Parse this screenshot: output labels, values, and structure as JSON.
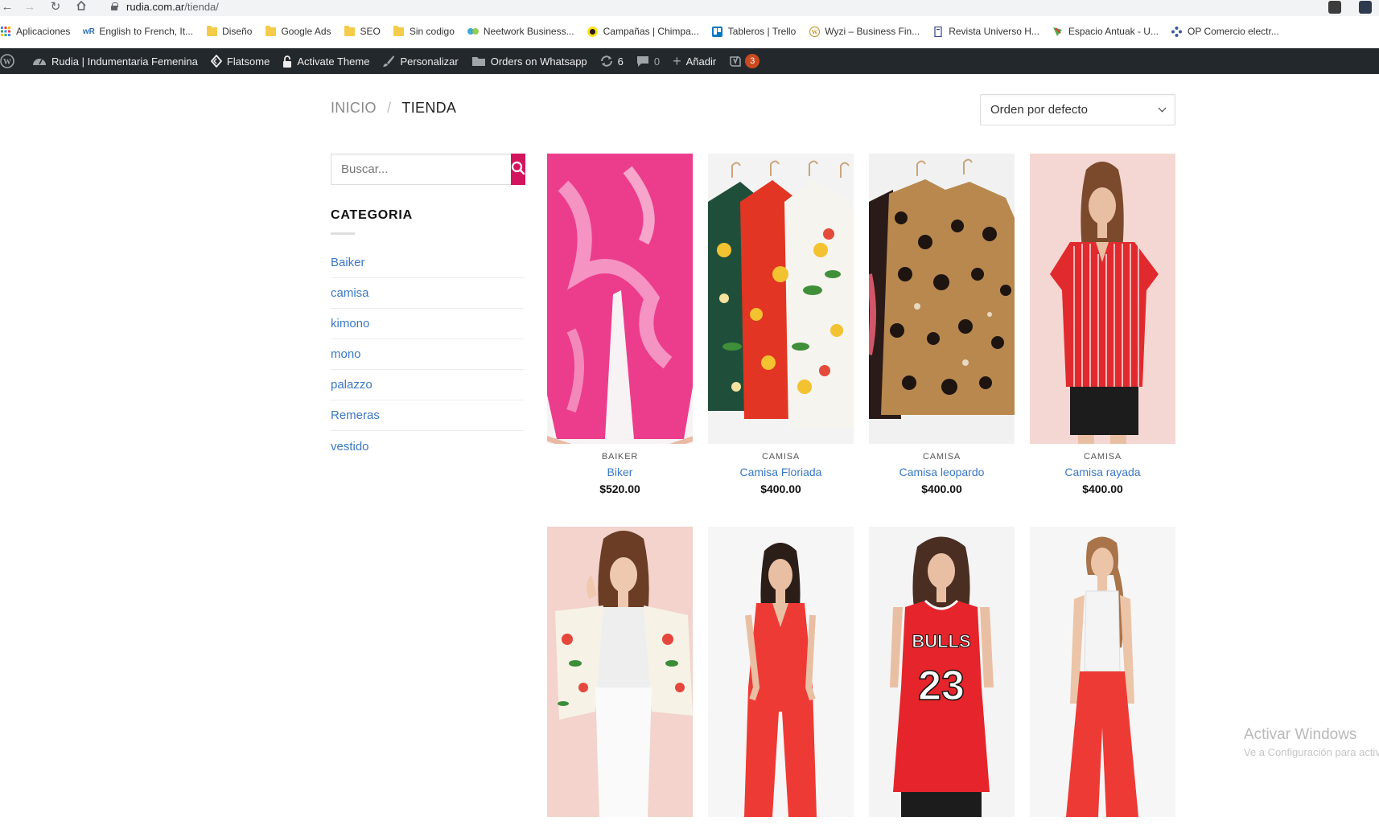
{
  "browser": {
    "url_host": "rudia.com.ar",
    "url_path": "/tienda/",
    "bookmarks": [
      {
        "label": "Aplicaciones",
        "icon": "apps-grid-icon"
      },
      {
        "label": "English to French, It...",
        "icon": "wordreference-icon"
      },
      {
        "label": "Diseño",
        "icon": "folder-icon"
      },
      {
        "label": "Google Ads",
        "icon": "folder-icon"
      },
      {
        "label": "SEO",
        "icon": "folder-icon"
      },
      {
        "label": "Sin codigo",
        "icon": "folder-icon"
      },
      {
        "label": "Neetwork Business...",
        "icon": "neetwork-icon"
      },
      {
        "label": "Campañas | Chimpa...",
        "icon": "mailchimp-icon"
      },
      {
        "label": "Tableros | Trello",
        "icon": "trello-icon"
      },
      {
        "label": "Wyzi – Business Fin...",
        "icon": "wordpress-icon"
      },
      {
        "label": "Revista Universo H...",
        "icon": "page-icon"
      },
      {
        "label": "Espacio Antuak - U...",
        "icon": "antuak-icon"
      },
      {
        "label": "OP Comercio electr...",
        "icon": "op-icon"
      }
    ]
  },
  "adminbar": {
    "site_name": "Rudia | Indumentaria Femenina",
    "flatsome": "Flatsome",
    "activate": "Activate Theme",
    "customize": "Personalizar",
    "whatsapp": "Orders on Whatsapp",
    "updates_count": "6",
    "comments_count": "0",
    "add_new": "Añadir",
    "yoast_badge": "3"
  },
  "breadcrumb": {
    "home": "INICIO",
    "separator": "/",
    "current": "TIENDA"
  },
  "orderby": {
    "selected": "Orden por defecto"
  },
  "search": {
    "placeholder": "Buscar..."
  },
  "sidebar": {
    "title": "CATEGORIA",
    "categories": [
      "Baiker",
      "camisa",
      "kimono",
      "mono",
      "palazzo",
      "Remeras",
      "vestido"
    ]
  },
  "products": [
    {
      "category": "BAIKER",
      "name": "Biker",
      "price": "$520.00"
    },
    {
      "category": "CAMISA",
      "name": "Camisa Floriada",
      "price": "$400.00"
    },
    {
      "category": "CAMISA",
      "name": "Camisa leopardo",
      "price": "$400.00"
    },
    {
      "category": "CAMISA",
      "name": "Camisa rayada",
      "price": "$400.00"
    },
    {
      "category": "",
      "name": "",
      "price": ""
    },
    {
      "category": "",
      "name": "",
      "price": ""
    },
    {
      "category": "",
      "name": "",
      "price": ""
    },
    {
      "category": "",
      "name": "",
      "price": ""
    }
  ],
  "overlay": {
    "watermark_title": "Activar Windows",
    "watermark_sub": "Ve a Configuración para activar Windows."
  },
  "colors": {
    "accent": "#d2155d",
    "link": "#3b78c4",
    "adminbar": "#23282d"
  }
}
